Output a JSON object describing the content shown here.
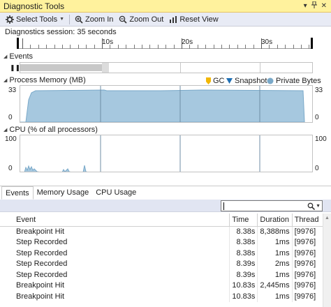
{
  "window": {
    "title": "Diagnostic Tools"
  },
  "toolbar": {
    "select_tools_label": "Select Tools",
    "zoom_in_label": "Zoom In",
    "zoom_out_label": "Zoom Out",
    "reset_view_label": "Reset View"
  },
  "session": {
    "text": "Diagnostics session: 35 seconds"
  },
  "timeline": {
    "tick_labels": [
      "10s",
      "20s",
      "30s"
    ]
  },
  "events_section": {
    "label": "Events"
  },
  "memory_section": {
    "label": "Process Memory (MB)",
    "legend": [
      {
        "label": "GC",
        "color": "#f2b705",
        "icon": "gc-marker-icon"
      },
      {
        "label": "Snapshot",
        "color": "#1f6fb4",
        "icon": "snapshot-triangle-icon"
      },
      {
        "label": "Private Bytes",
        "color": "#9ec4dd",
        "icon": "private-bytes-dot-icon"
      }
    ],
    "ymax_left": "33",
    "ymin_left": "0",
    "ymax_right": "33",
    "ymin_right": "0"
  },
  "cpu_section": {
    "label": "CPU (% of all processors)",
    "ymax_left": "100",
    "ymin_left": "0",
    "ymax_right": "100",
    "ymin_right": "0"
  },
  "bottom_tabs": [
    "Events",
    "Memory Usage",
    "CPU Usage"
  ],
  "search": {
    "placeholder": ""
  },
  "table": {
    "columns": [
      "Event",
      "Time",
      "Duration",
      "Thread"
    ],
    "rows": [
      [
        "Breakpoint Hit",
        "8.38s",
        "8,388ms",
        "[9976]"
      ],
      [
        "Step Recorded",
        "8.38s",
        "1ms",
        "[9976]"
      ],
      [
        "Step Recorded",
        "8.38s",
        "1ms",
        "[9976]"
      ],
      [
        "Step Recorded",
        "8.39s",
        "2ms",
        "[9976]"
      ],
      [
        "Step Recorded",
        "8.39s",
        "1ms",
        "[9976]"
      ],
      [
        "Breakpoint Hit",
        "10.83s",
        "2,445ms",
        "[9976]"
      ],
      [
        "Breakpoint Hit",
        "10.83s",
        "1ms",
        "[9976]"
      ]
    ]
  },
  "colors": {
    "titlebar": "#fff29d",
    "memory_fill": "#a6c8df",
    "memory_line": "#7aa9c9",
    "cpu_fill": "#a6c8df"
  }
}
